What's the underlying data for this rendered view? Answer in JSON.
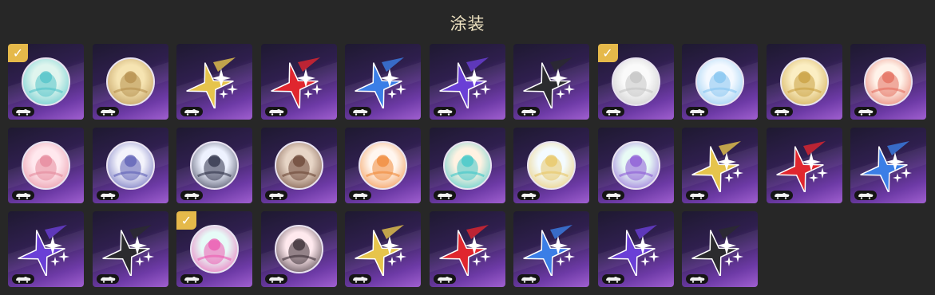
{
  "header": {
    "title": "涂装"
  },
  "colors": {
    "selected_badge": "#e5b94a",
    "tile_bottom": "#a05fd0"
  },
  "tiles": [
    {
      "kind": "circle",
      "icon": "teal-wave-emblem-icon",
      "c1": "#dff5ee",
      "c2": "#52c3c8",
      "selected": true
    },
    {
      "kind": "circle",
      "icon": "girl-portrait-gold-icon",
      "c1": "#f6e4b2",
      "c2": "#b58f4e",
      "selected": false
    },
    {
      "kind": "stars",
      "icon": "gold-star-icon",
      "color": "#e6c44c",
      "selected": false
    },
    {
      "kind": "stars",
      "icon": "red-star-icon",
      "color": "#e0262e",
      "selected": false
    },
    {
      "kind": "stars",
      "icon": "blue-star-icon",
      "color": "#3b7ee6",
      "selected": false
    },
    {
      "kind": "stars",
      "icon": "purple-star-icon",
      "color": "#6a3fd6",
      "selected": false
    },
    {
      "kind": "stars",
      "icon": "black-star-icon",
      "color": "#2b2b2e",
      "selected": false
    },
    {
      "kind": "circle",
      "icon": "armored-mascot-icon",
      "c1": "#fafafa",
      "c2": "#c4c4c4",
      "selected": true
    },
    {
      "kind": "circle",
      "icon": "blue-wave-emblem-icon",
      "c1": "#f4f9ff",
      "c2": "#86c5f0",
      "selected": false
    },
    {
      "kind": "circle",
      "icon": "gold-compass-emblem-icon",
      "c1": "#fbeec3",
      "c2": "#c9a042",
      "selected": false
    },
    {
      "kind": "circle",
      "icon": "fox-girl-portrait-icon",
      "c1": "#fff3ea",
      "c2": "#e46d5d",
      "selected": false
    },
    {
      "kind": "circle",
      "icon": "pink-girl-portrait-icon",
      "c1": "#ffe8ee",
      "c2": "#e58a9c",
      "selected": false
    },
    {
      "kind": "circle",
      "icon": "purple-crest-emblem-icon",
      "c1": "#f3f3fb",
      "c2": "#5d5fb5",
      "selected": false
    },
    {
      "kind": "circle",
      "icon": "boy-portrait-icon",
      "c1": "#eef2ff",
      "c2": "#2f3248",
      "selected": false
    },
    {
      "kind": "circle",
      "icon": "duo-portrait-icon",
      "c1": "#e7d5c6",
      "c2": "#6b4636",
      "selected": false
    },
    {
      "kind": "circle",
      "icon": "cute-mascots-icon",
      "c1": "#fff6ef",
      "c2": "#f08a3a",
      "selected": false
    },
    {
      "kind": "circle",
      "icon": "cyan-mech-emblem-icon",
      "c1": "#fff2e2",
      "c2": "#3fc7c8",
      "selected": false
    },
    {
      "kind": "circle",
      "icon": "blonde-chibi-portrait-icon",
      "c1": "#f4fbff",
      "c2": "#e8c766",
      "selected": false
    },
    {
      "kind": "circle",
      "icon": "candy-orbit-emblem-icon",
      "c1": "#e8fbf5",
      "c2": "#8c5bd6",
      "selected": false
    },
    {
      "kind": "stars",
      "icon": "gold-star-icon",
      "color": "#e6c44c",
      "selected": false
    },
    {
      "kind": "stars",
      "icon": "red-star-icon",
      "color": "#e0262e",
      "selected": false
    },
    {
      "kind": "stars",
      "icon": "blue-star-icon",
      "color": "#3b7ee6",
      "selected": false
    },
    {
      "kind": "stars",
      "icon": "purple-star-icon",
      "color": "#6a3fd6",
      "selected": false
    },
    {
      "kind": "stars",
      "icon": "black-star-icon",
      "color": "#2b2b2e",
      "selected": false
    },
    {
      "kind": "circle",
      "icon": "pink-cat-emblem-icon",
      "c1": "#e6fbf7",
      "c2": "#ec5ab1",
      "selected": true
    },
    {
      "kind": "circle",
      "icon": "dark-hair-portrait-icon",
      "c1": "#ffe9ee",
      "c2": "#3a2d35",
      "selected": false
    },
    {
      "kind": "stars",
      "icon": "gold-star-icon",
      "color": "#e6c44c",
      "selected": false
    },
    {
      "kind": "stars",
      "icon": "red-star-icon",
      "color": "#e0262e",
      "selected": false
    },
    {
      "kind": "stars",
      "icon": "blue-star-icon",
      "color": "#3b7ee6",
      "selected": false
    },
    {
      "kind": "stars",
      "icon": "purple-star-icon",
      "color": "#6a3fd6",
      "selected": false
    },
    {
      "kind": "stars",
      "icon": "black-star-icon",
      "color": "#2b2b2e",
      "selected": false
    }
  ]
}
